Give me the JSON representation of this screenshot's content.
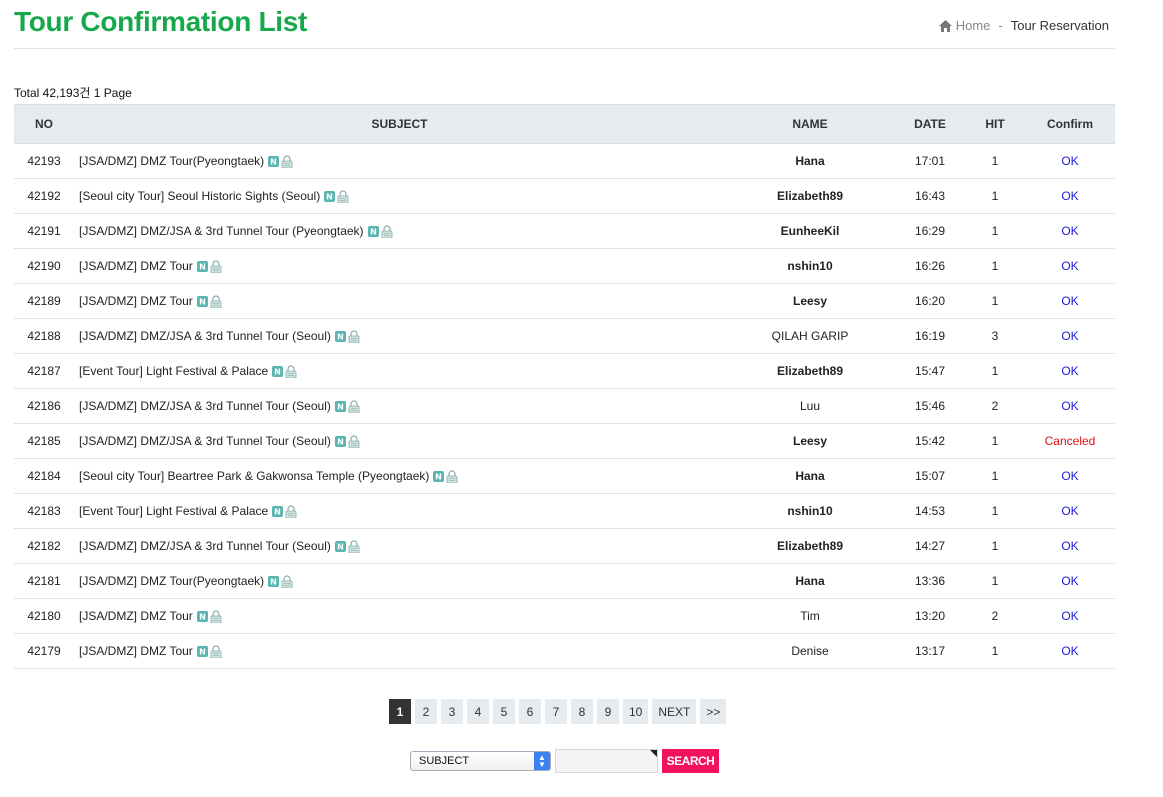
{
  "page": {
    "title": "Tour Confirmation List",
    "breadcrumb": {
      "home": "Home",
      "separator": "-",
      "current": "Tour Reservation"
    },
    "total_text": "Total 42,193건 1 Page"
  },
  "colors": {
    "title": "#16a84a",
    "ok": "#1a1adb",
    "canceled": "#e01010",
    "search_button": "#f2115e"
  },
  "table": {
    "headers": {
      "no": "NO",
      "subject": "SUBJECT",
      "name": "NAME",
      "date": "DATE",
      "hit": "HIT",
      "confirm": "Confirm"
    },
    "rows": [
      {
        "no": "42193",
        "subject": "[JSA/DMZ] DMZ Tour(Pyeongtaek)",
        "name": "Hana",
        "name_bold": true,
        "date": "17:01",
        "hit": "1",
        "confirm": "OK",
        "status": "ok"
      },
      {
        "no": "42192",
        "subject": "[Seoul city Tour] Seoul Historic Sights (Seoul)",
        "name": "Elizabeth89",
        "name_bold": true,
        "date": "16:43",
        "hit": "1",
        "confirm": "OK",
        "status": "ok"
      },
      {
        "no": "42191",
        "subject": "[JSA/DMZ] DMZ/JSA & 3rd Tunnel Tour (Pyeongtaek)",
        "name": "EunheeKil",
        "name_bold": true,
        "date": "16:29",
        "hit": "1",
        "confirm": "OK",
        "status": "ok"
      },
      {
        "no": "42190",
        "subject": "[JSA/DMZ] DMZ Tour",
        "name": "nshin10",
        "name_bold": true,
        "date": "16:26",
        "hit": "1",
        "confirm": "OK",
        "status": "ok"
      },
      {
        "no": "42189",
        "subject": "[JSA/DMZ] DMZ Tour",
        "name": "Leesy",
        "name_bold": true,
        "date": "16:20",
        "hit": "1",
        "confirm": "OK",
        "status": "ok"
      },
      {
        "no": "42188",
        "subject": "[JSA/DMZ] DMZ/JSA & 3rd Tunnel Tour (Seoul)",
        "name": "QILAH GARIP",
        "name_bold": false,
        "date": "16:19",
        "hit": "3",
        "confirm": "OK",
        "status": "ok"
      },
      {
        "no": "42187",
        "subject": "[Event Tour] Light Festival & Palace",
        "name": "Elizabeth89",
        "name_bold": true,
        "date": "15:47",
        "hit": "1",
        "confirm": "OK",
        "status": "ok"
      },
      {
        "no": "42186",
        "subject": "[JSA/DMZ] DMZ/JSA & 3rd Tunnel Tour (Seoul)",
        "name": "Luu",
        "name_bold": false,
        "date": "15:46",
        "hit": "2",
        "confirm": "OK",
        "status": "ok"
      },
      {
        "no": "42185",
        "subject": "[JSA/DMZ] DMZ/JSA & 3rd Tunnel Tour (Seoul)",
        "name": "Leesy",
        "name_bold": true,
        "date": "15:42",
        "hit": "1",
        "confirm": "Canceled",
        "status": "canceled"
      },
      {
        "no": "42184",
        "subject": "[Seoul city Tour] Beartree Park & Gakwonsa Temple (Pyeongtaek)",
        "name": "Hana",
        "name_bold": true,
        "date": "15:07",
        "hit": "1",
        "confirm": "OK",
        "status": "ok"
      },
      {
        "no": "42183",
        "subject": "[Event Tour] Light Festival & Palace",
        "name": "nshin10",
        "name_bold": true,
        "date": "14:53",
        "hit": "1",
        "confirm": "OK",
        "status": "ok"
      },
      {
        "no": "42182",
        "subject": "[JSA/DMZ] DMZ/JSA & 3rd Tunnel Tour (Seoul)",
        "name": "Elizabeth89",
        "name_bold": true,
        "date": "14:27",
        "hit": "1",
        "confirm": "OK",
        "status": "ok"
      },
      {
        "no": "42181",
        "subject": "[JSA/DMZ] DMZ Tour(Pyeongtaek)",
        "name": "Hana",
        "name_bold": true,
        "date": "13:36",
        "hit": "1",
        "confirm": "OK",
        "status": "ok"
      },
      {
        "no": "42180",
        "subject": "[JSA/DMZ] DMZ Tour",
        "name": "Tim",
        "name_bold": false,
        "date": "13:20",
        "hit": "2",
        "confirm": "OK",
        "status": "ok"
      },
      {
        "no": "42179",
        "subject": "[JSA/DMZ] DMZ Tour",
        "name": "Denise",
        "name_bold": false,
        "date": "13:17",
        "hit": "1",
        "confirm": "OK",
        "status": "ok"
      }
    ],
    "row_icons": [
      "new-badge-icon",
      "lock-icon"
    ]
  },
  "pagination": {
    "pages": [
      "1",
      "2",
      "3",
      "4",
      "5",
      "6",
      "7",
      "8",
      "9",
      "10"
    ],
    "current": "1",
    "next_label": "NEXT",
    "last_label": ">>"
  },
  "search": {
    "select_value": "SUBJECT",
    "input_value": "",
    "button_label": "SEARCH"
  }
}
